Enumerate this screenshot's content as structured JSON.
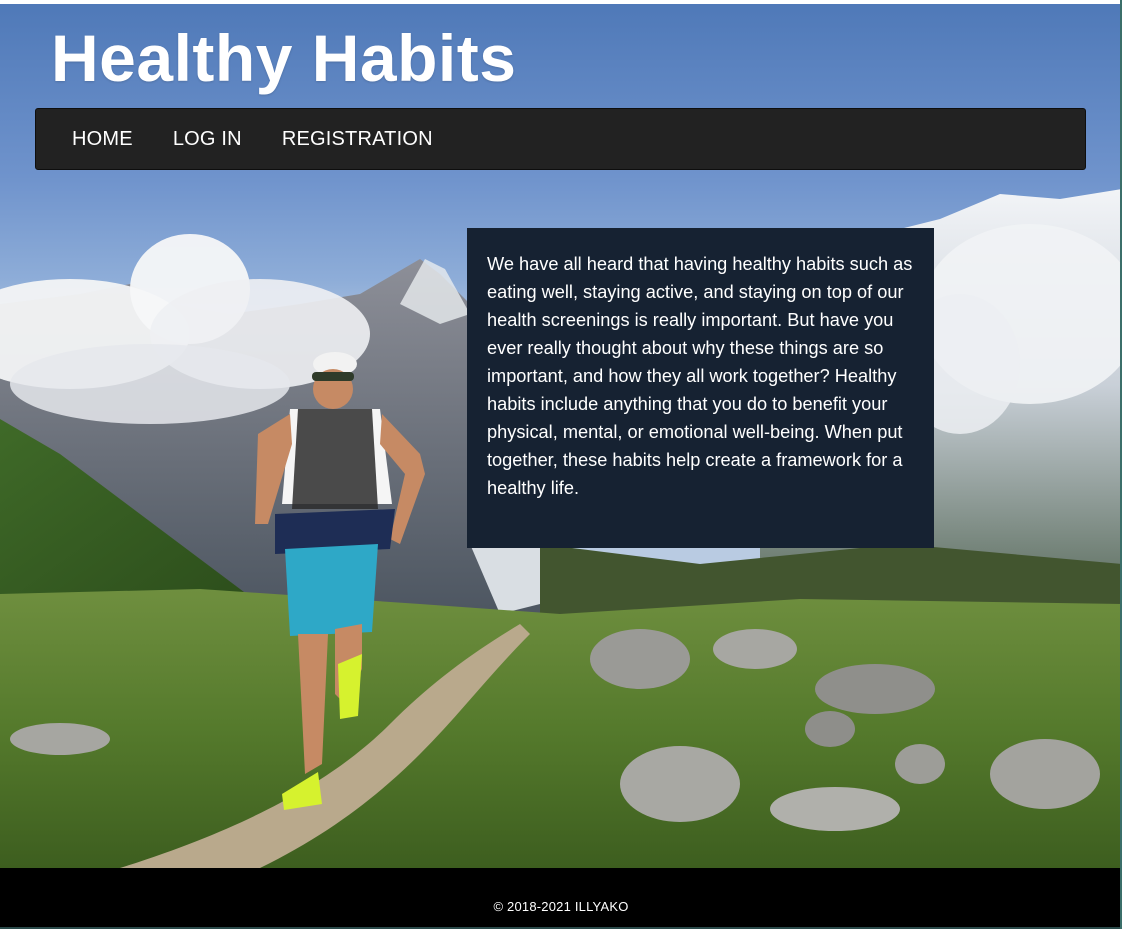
{
  "header": {
    "site_title": "Healthy Habits"
  },
  "nav": {
    "items": [
      {
        "label": "HOME"
      },
      {
        "label": "LOG IN"
      },
      {
        "label": "REGISTRATION"
      }
    ]
  },
  "main": {
    "intro": "We have all heard that having healthy habits such as eating well, staying active, and staying on top of our health screenings is really important. But have you ever really thought about why these things are so important, and how they all work together? Healthy habits include anything that you do to benefit your physical, mental, or emotional well-being. When put together, these habits help create a framework for a healthy life."
  },
  "footer": {
    "copyright": "© 2018-2021 ILLYAKO"
  },
  "colors": {
    "nav_background": "#222222",
    "panel_background": "#162232",
    "footer_background": "#000000",
    "text": "#ffffff"
  }
}
